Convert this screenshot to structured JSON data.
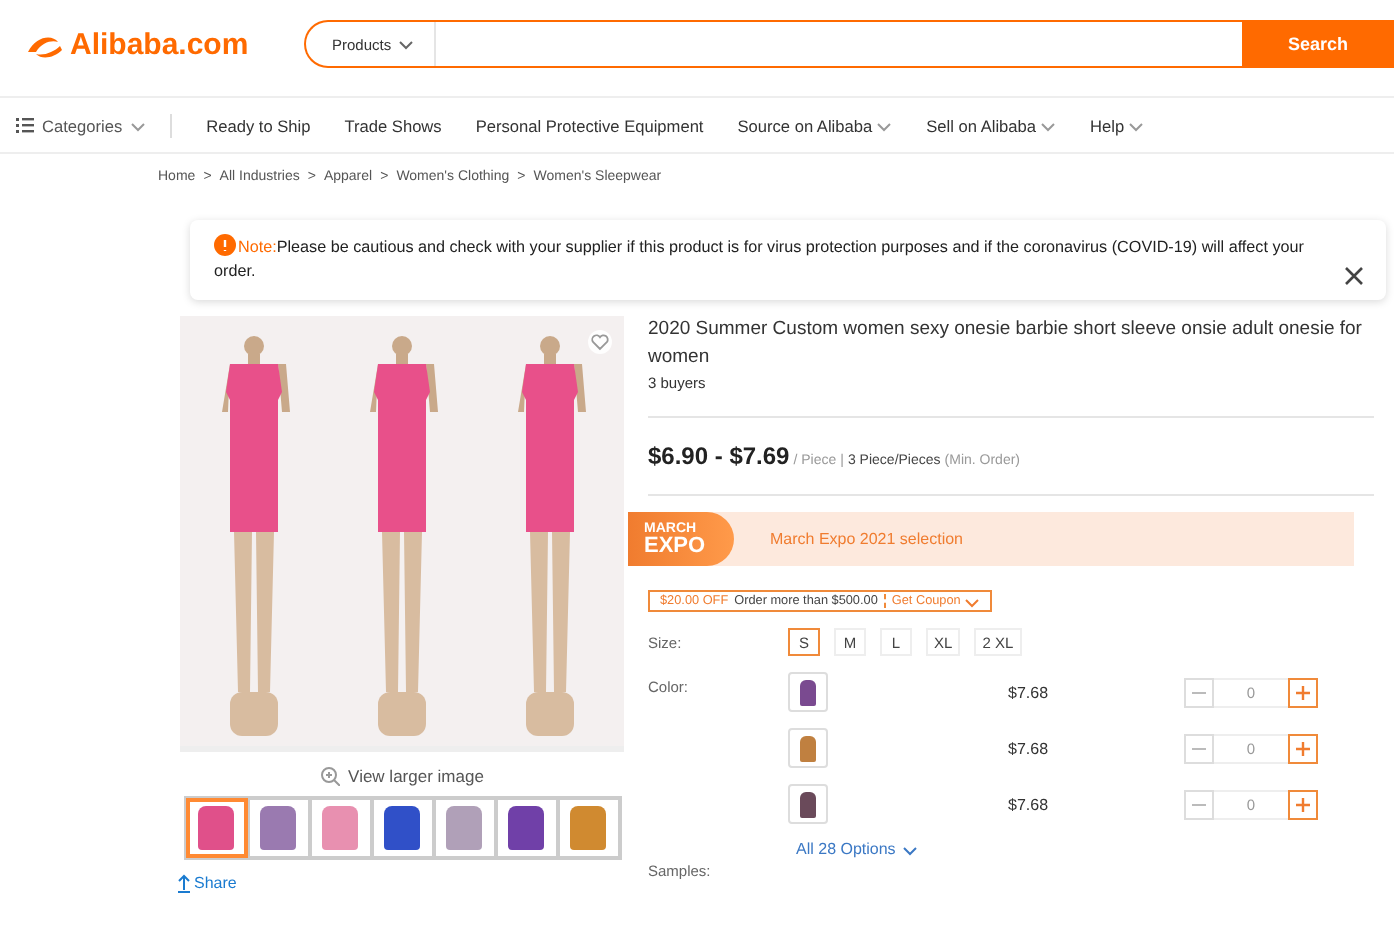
{
  "header": {
    "logo": "Alibaba.com",
    "search_category": "Products",
    "search_button": "Search"
  },
  "nav": {
    "categories": "Categories",
    "items": [
      {
        "label": "Ready to Ship",
        "dropdown": false
      },
      {
        "label": "Trade Shows",
        "dropdown": false
      },
      {
        "label": "Personal Protective Equipment",
        "dropdown": false
      },
      {
        "label": "Source on Alibaba",
        "dropdown": true
      },
      {
        "label": "Sell on Alibaba",
        "dropdown": true
      },
      {
        "label": "Help",
        "dropdown": true
      }
    ]
  },
  "breadcrumb_separator": ">",
  "breadcrumb": [
    "Home",
    "All Industries",
    "Apparel",
    "Women's Clothing",
    "Women's Sleepwear"
  ],
  "note": {
    "label": "Note:",
    "text": "Please be cautious and check with your supplier if this product is for virus protection purposes and if the coronavirus (COVID-19) will affect your order."
  },
  "gallery": {
    "view_larger": "View larger image",
    "thumbnails": [
      {
        "selected": true,
        "color": "#e0508a"
      },
      {
        "selected": false,
        "color": "#9a7ab0"
      },
      {
        "selected": false,
        "color": "#e890b0"
      },
      {
        "selected": false,
        "color": "#3050c8"
      },
      {
        "selected": false,
        "color": "#b0a0b8"
      },
      {
        "selected": false,
        "color": "#7040a8"
      },
      {
        "selected": false,
        "color": "#d08a30"
      }
    ],
    "share": "Share"
  },
  "product": {
    "title": "2020 Summer Custom women sexy onesie barbie short sleeve onsie adult onesie for women",
    "buyers": "3 buyers",
    "price": "$6.90 - $7.69",
    "unit": "/ Piece",
    "price_separator": "|",
    "min_order": "3 Piece/Pieces",
    "min_order_note": "(Min. Order)",
    "expo": {
      "badge_top": "MARCH",
      "badge_bottom": "EXPO",
      "text": "March Expo 2021 selection"
    },
    "coupon": {
      "discount": "$20.00 OFF",
      "condition": "Order more than $500.00",
      "action": "Get Coupon"
    },
    "size_label": "Size:",
    "sizes": [
      {
        "label": "S",
        "selected": true
      },
      {
        "label": "M",
        "selected": false
      },
      {
        "label": "L",
        "selected": false
      },
      {
        "label": "XL",
        "selected": false
      },
      {
        "label": "2 XL",
        "selected": false
      }
    ],
    "color_label": "Color:",
    "variants": [
      {
        "color": "#7a4a90",
        "price": "$7.68",
        "quantity": "0"
      },
      {
        "color": "#c08040",
        "price": "$7.68",
        "quantity": "0"
      },
      {
        "color": "#6a4a5a",
        "price": "$7.68",
        "quantity": "0"
      }
    ],
    "all_options": "All 28 Options",
    "samples_label": "Samples:"
  }
}
